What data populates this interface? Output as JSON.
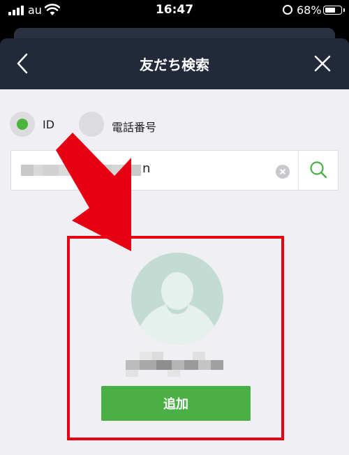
{
  "status_bar": {
    "carrier": "au",
    "time": "16:47",
    "battery": "68%",
    "battery_level": 0.68
  },
  "header": {
    "title": "友だち検索"
  },
  "search_type": {
    "options": [
      {
        "label": "ID",
        "selected": true
      },
      {
        "label": "電話番号",
        "selected": false
      }
    ]
  },
  "search": {
    "value_visible_char": "n"
  },
  "result": {
    "add_label": "追加"
  },
  "colors": {
    "header_bg": "#222a3a",
    "accent_green": "#4ab046",
    "annotation_red": "#e60012",
    "avatar_bg": "#c2dbd3"
  }
}
